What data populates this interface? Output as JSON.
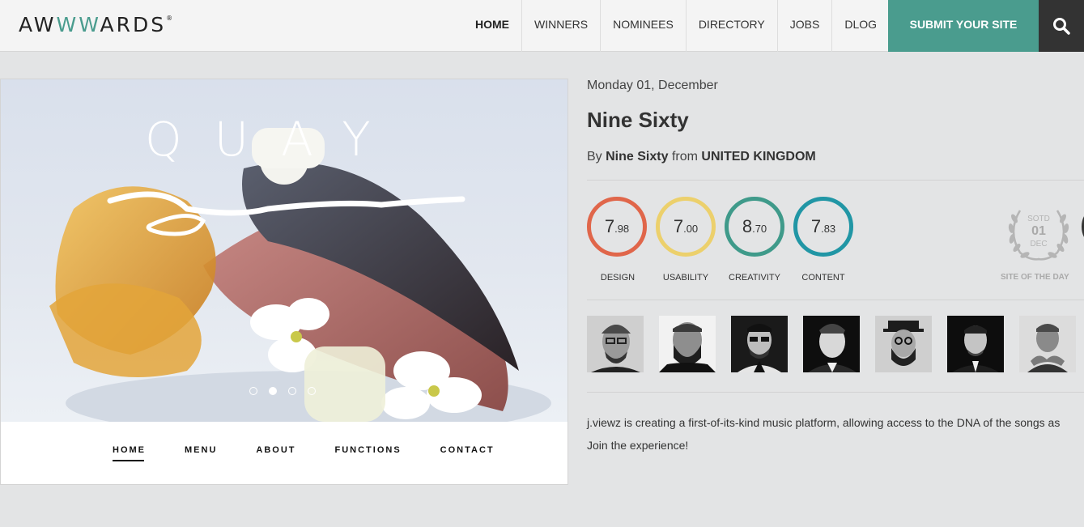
{
  "header": {
    "logo": {
      "pre": "AW",
      "highlight": "WW",
      "post": "ARDS",
      "mark": "®"
    },
    "nav": [
      "HOME",
      "WINNERS",
      "NOMINEES",
      "DIRECTORY",
      "JOBS",
      "DLOG"
    ],
    "active_nav": "HOME",
    "submit_label": "SUBMIT YOUR SITE",
    "search_icon": "search-icon"
  },
  "preview": {
    "hero_text": "QUAY",
    "slides": 4,
    "active_slide": 2,
    "site_nav": [
      "HOME",
      "MENU",
      "ABOUT",
      "FUNCTIONS",
      "CONTACT"
    ]
  },
  "info": {
    "date": "Monday 01, December",
    "title": "Nine Sixty",
    "by_prefix": "By",
    "author": "Nine Sixty",
    "from_word": "from",
    "country": "UNITED KINGDOM"
  },
  "scores": [
    {
      "int": "7",
      "dec": ".98",
      "label": "DESIGN",
      "color": "#e0664a"
    },
    {
      "int": "7",
      "dec": ".00",
      "label": "USABILITY",
      "color": "#ecd06c"
    },
    {
      "int": "8",
      "dec": ".70",
      "label": "CREATIVITY",
      "color": "#3f9a8a"
    },
    {
      "int": "7",
      "dec": ".83",
      "label": "CONTENT",
      "color": "#2196a5"
    }
  ],
  "sotd": {
    "top": "SOTD",
    "day": "01",
    "month": "DEC",
    "label": "SITE OF THE DAY"
  },
  "jury_count": 7,
  "description": {
    "line1": "j.viewz is creating a first-of-its-kind music platform, allowing access to the DNA of the songs as",
    "line2": "Join the experience!"
  },
  "colors": {
    "accent": "#4a9c8e",
    "dark": "#333333",
    "bg": "#e3e4e5"
  }
}
